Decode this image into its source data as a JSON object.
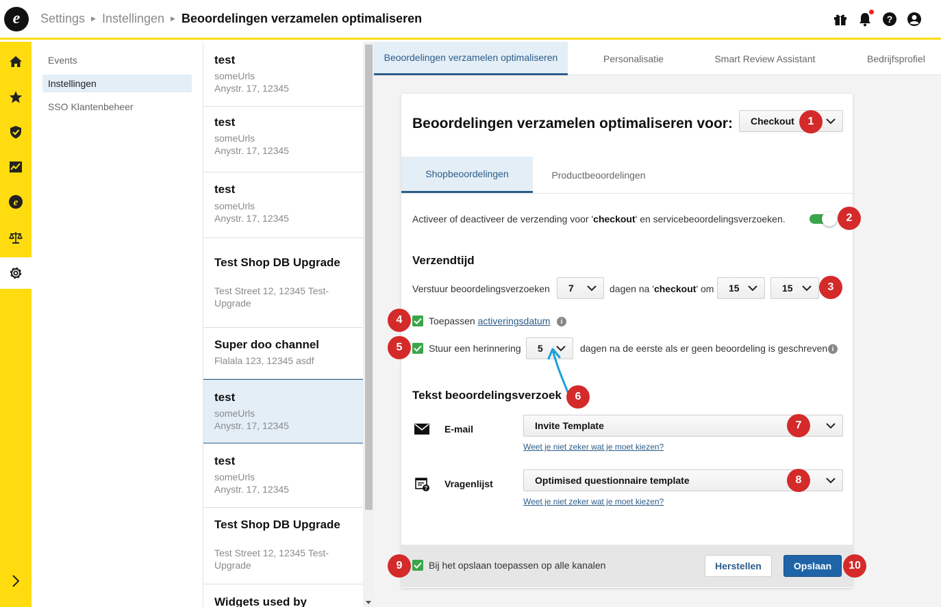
{
  "header": {
    "logo_letter": "e",
    "breadcrumb": [
      "Settings",
      "Instellingen",
      "Beoordelingen verzamelen optimaliseren"
    ],
    "icons": [
      "gift-icon",
      "bell-icon",
      "help-icon",
      "account-icon"
    ]
  },
  "rail": {
    "items": [
      "home-icon",
      "star-icon",
      "shield-check-icon",
      "chart-icon",
      "trusted-logo-icon",
      "scales-icon",
      "gear-icon"
    ],
    "expand_icon": "chevron-right-icon",
    "accent": "#ffdc0f"
  },
  "settings_nav": {
    "items": [
      {
        "label": "Events"
      },
      {
        "label": "Instellingen"
      },
      {
        "label": "SSO Klantenbeheer"
      }
    ]
  },
  "channels": [
    {
      "title": "test",
      "lines": [
        "someUrls",
        "Anystr. 17, 12345"
      ]
    },
    {
      "title": "test",
      "lines": [
        "someUrls",
        "Anystr. 17, 12345"
      ]
    },
    {
      "title": "test",
      "lines": [
        "someUrls",
        "Anystr. 17, 12345"
      ]
    },
    {
      "title": "Test Shop DB Upgrade",
      "lines": [
        "Test Street 12, 12345 Test-",
        "Upgrade"
      ]
    },
    {
      "title": "Super doo channel",
      "lines": [
        "Flalala 123, 12345 asdf"
      ]
    },
    {
      "title": "test",
      "lines": [
        "someUrls",
        "Anystr. 17, 12345"
      ]
    },
    {
      "title": "test",
      "lines": [
        "someUrls",
        "Anystr. 17, 12345"
      ]
    },
    {
      "title": "Test Shop DB Upgrade",
      "lines": [
        "Test Street 12, 12345 Test-",
        "Upgrade"
      ]
    },
    {
      "title": "Widgets used by",
      "lines": []
    }
  ],
  "main_tabs": [
    "Beoordelingen verzamelen optimaliseren",
    "Personalisatie",
    "Smart Review Assistant",
    "Bedrijfsprofiel"
  ],
  "card": {
    "title": "Beoordelingen verzamelen optimaliseren voor:",
    "event_select": "Checkout",
    "subtabs": [
      "Shopbeoordelingen",
      "Productbeoordelingen"
    ],
    "toggle_text_pre": "Activeer of deactiveer de verzending voor '",
    "toggle_text_bold": "checkout",
    "toggle_text_post": "' en servicebeoordelingsverzoeken.",
    "toggle_on": true,
    "send_time_heading": "Verzendtijd",
    "send_pre": "Verstuur beoordelingsverzoeken",
    "days_value": "7",
    "send_mid_pre": "dagen na '",
    "send_mid_bold": "checkout",
    "send_mid_post": "' om",
    "hour_value": "15",
    "minute_value": "15",
    "apply_label": "Toepassen",
    "apply_link": "activeringsdatum",
    "reminder_label": "Stuur een herinnering",
    "reminder_days": "5",
    "reminder_post": "dagen na de eerste als er geen beoordeling is geschreven",
    "text_heading": "Tekst beoordelingsverzoek",
    "email_label": "E-mail",
    "email_template": "Invite Template",
    "help_link": "Weet je niet zeker wat je moet kiezen?",
    "questionnaire_label": "Vragenlijst",
    "questionnaire_template": "Optimised questionnaire template"
  },
  "footer": {
    "apply_all_label": "Bij het opslaan toepassen op alle kanalen",
    "reset_button": "Herstellen",
    "save_button": "Opslaan"
  },
  "annotations": [
    "1",
    "2",
    "3",
    "4",
    "5",
    "6",
    "7",
    "8",
    "9",
    "10"
  ],
  "colors": {
    "brand_yellow": "#ffdc0f",
    "accent_blue": "#2b5c8a",
    "toggle_green": "#3aa64a",
    "annotation_red": "#d42a2a",
    "arrow_blue": "#1ba0d8"
  }
}
